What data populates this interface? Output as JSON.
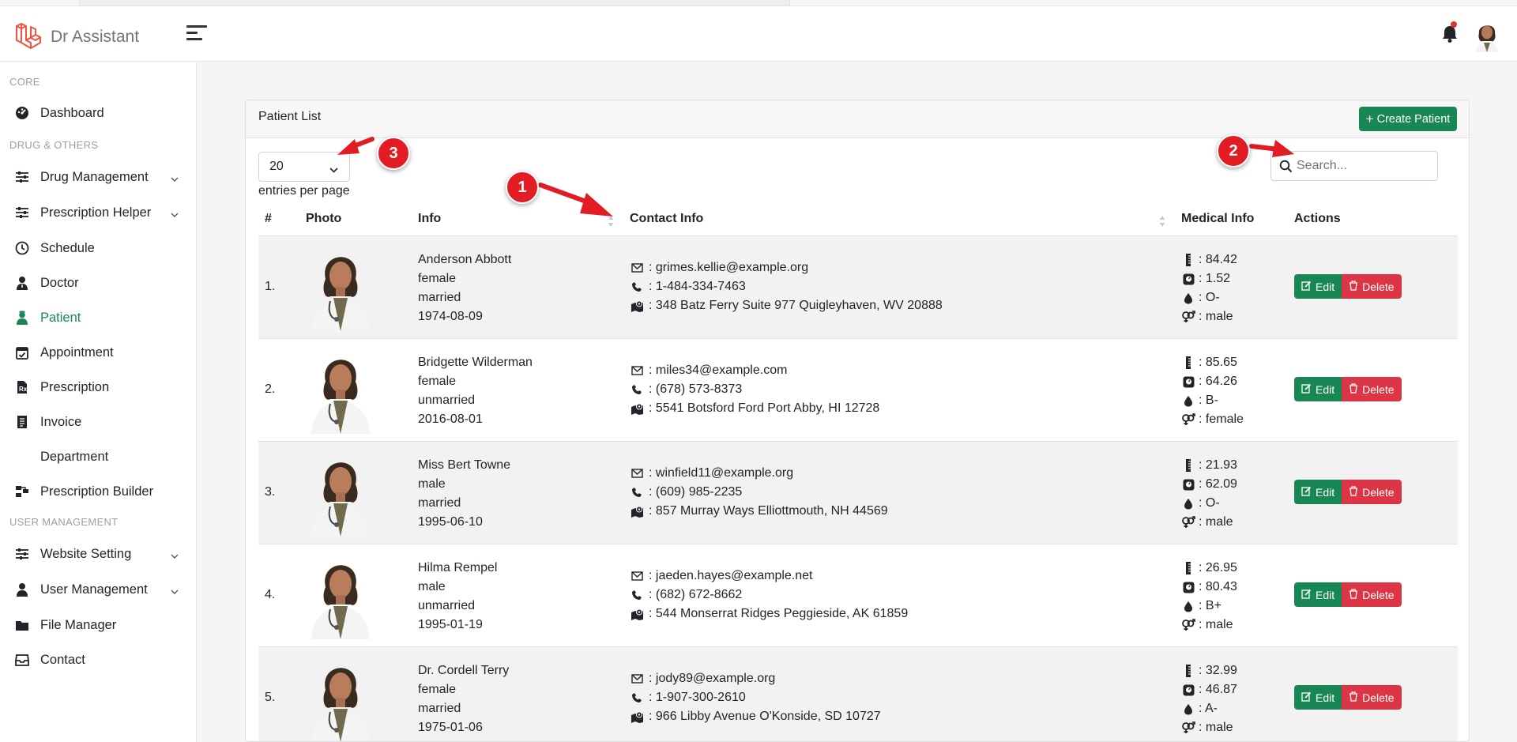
{
  "app": {
    "brand_name": "Dr Assistant",
    "accent_color": "#198754",
    "danger_color": "#dc3545"
  },
  "sidebar": {
    "headings": {
      "core": "CORE",
      "drug": "DRUG & OTHERS",
      "user": "USER MANAGEMENT"
    },
    "items": [
      {
        "label": "Dashboard",
        "icon": "dashboard-gauge-icon"
      },
      {
        "label": "Drug Management",
        "icon": "sliders-icon",
        "expandable": true
      },
      {
        "label": "Prescription Helper",
        "icon": "sliders-icon",
        "expandable": true
      },
      {
        "label": "Schedule",
        "icon": "clock-icon"
      },
      {
        "label": "Doctor",
        "icon": "user-doctor-icon"
      },
      {
        "label": "Patient",
        "icon": "user-nurse-icon",
        "active": true
      },
      {
        "label": "Appointment",
        "icon": "calendar-check-icon"
      },
      {
        "label": "Prescription",
        "icon": "file-prescription-icon"
      },
      {
        "label": "Invoice",
        "icon": "invoice-icon"
      },
      {
        "label": "Department",
        "icon": ""
      },
      {
        "label": "Prescription Builder",
        "icon": "builder-icon"
      },
      {
        "label": "Website Setting",
        "icon": "sliders-icon",
        "expandable": true
      },
      {
        "label": "User Management",
        "icon": "user-icon",
        "expandable": true
      },
      {
        "label": "File Manager",
        "icon": "folder-icon"
      },
      {
        "label": "Contact",
        "icon": "inbox-icon"
      }
    ]
  },
  "card": {
    "title": "Patient List",
    "create_label": "Create Patient"
  },
  "table_controls": {
    "per_page_value": "20",
    "per_page_label": "entries per page",
    "search_placeholder": "Search..."
  },
  "columns": [
    "#",
    "Photo",
    "Info",
    "Contact Info",
    "Medical Info",
    "Actions"
  ],
  "patients": [
    {
      "index": "1.",
      "name": "Anderson Abbott",
      "gender": "female",
      "marital": "married",
      "dob": "1974-08-09",
      "email": ": grimes.kellie@example.org",
      "phone": ": 1-484-334-7463",
      "address": ": 348 Batz Ferry Suite 977 Quigleyhaven, WV 20888",
      "height": ": 84.42",
      "weight": ": 1.52",
      "blood": ": O-",
      "sex": ": male"
    },
    {
      "index": "2.",
      "name": "Bridgette Wilderman",
      "gender": "female",
      "marital": "unmarried",
      "dob": "2016-08-01",
      "email": ": miles34@example.com",
      "phone": ": (678) 573-8373",
      "address": ": 5541 Botsford Ford Port Abby, HI 12728",
      "height": ": 85.65",
      "weight": ": 64.26",
      "blood": ": B-",
      "sex": ": female"
    },
    {
      "index": "3.",
      "name": "Miss Bert Towne",
      "gender": "male",
      "marital": "married",
      "dob": "1995-06-10",
      "email": ": winfield11@example.org",
      "phone": ": (609) 985-2235",
      "address": ": 857 Murray Ways Elliottmouth, NH 44569",
      "height": ": 21.93",
      "weight": ": 62.09",
      "blood": ": O-",
      "sex": ": male"
    },
    {
      "index": "4.",
      "name": "Hilma Rempel",
      "gender": "male",
      "marital": "unmarried",
      "dob": "1995-01-19",
      "email": ": jaeden.hayes@example.net",
      "phone": ": (682) 672-8662",
      "address": ": 544 Monserrat Ridges Peggieside, AK 61859",
      "height": ": 26.95",
      "weight": ": 80.43",
      "blood": ": B+",
      "sex": ": male"
    },
    {
      "index": "5.",
      "name": "Dr. Cordell Terry",
      "gender": "female",
      "marital": "married",
      "dob": "1975-01-06",
      "email": ": jody89@example.org",
      "phone": ": 1-907-300-2610",
      "address": ": 966 Libby Avenue O'Konside, SD 10727",
      "height": ": 32.99",
      "weight": ": 46.87",
      "blood": ": A-",
      "sex": ": male"
    }
  ],
  "row_actions": {
    "edit_label": "Edit",
    "delete_label": "Delete"
  },
  "annotations": {
    "one": "1",
    "two": "2",
    "three": "3"
  }
}
